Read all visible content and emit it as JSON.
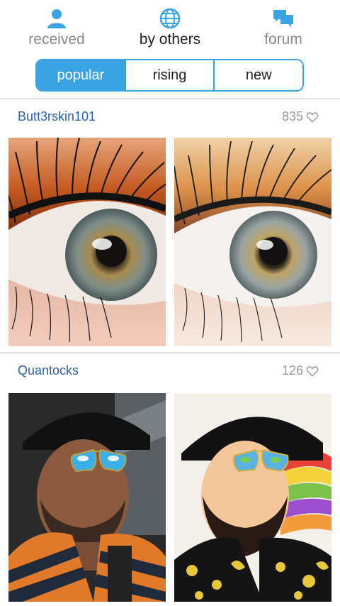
{
  "nav": [
    {
      "label": "received",
      "icon": "person-icon",
      "active": false
    },
    {
      "label": "by others",
      "icon": "globe-icon",
      "active": true
    },
    {
      "label": "forum",
      "icon": "chat-bubbles-icon",
      "active": false
    }
  ],
  "tabs": [
    {
      "label": "popular",
      "selected": true
    },
    {
      "label": "rising",
      "selected": false
    },
    {
      "label": "new",
      "selected": false
    }
  ],
  "posts": [
    {
      "user": "Butt3rskin101",
      "likes": "835",
      "original": "eye close-up photo",
      "painting": "eye painting"
    },
    {
      "user": "Quantocks",
      "likes": "126",
      "original": "man in hat and sunglasses photo",
      "painting": "man in hat painting"
    }
  ],
  "colors": {
    "accent": "#3aa3e3",
    "username": "#2f5fa8",
    "likes": "#9a9a9a"
  }
}
